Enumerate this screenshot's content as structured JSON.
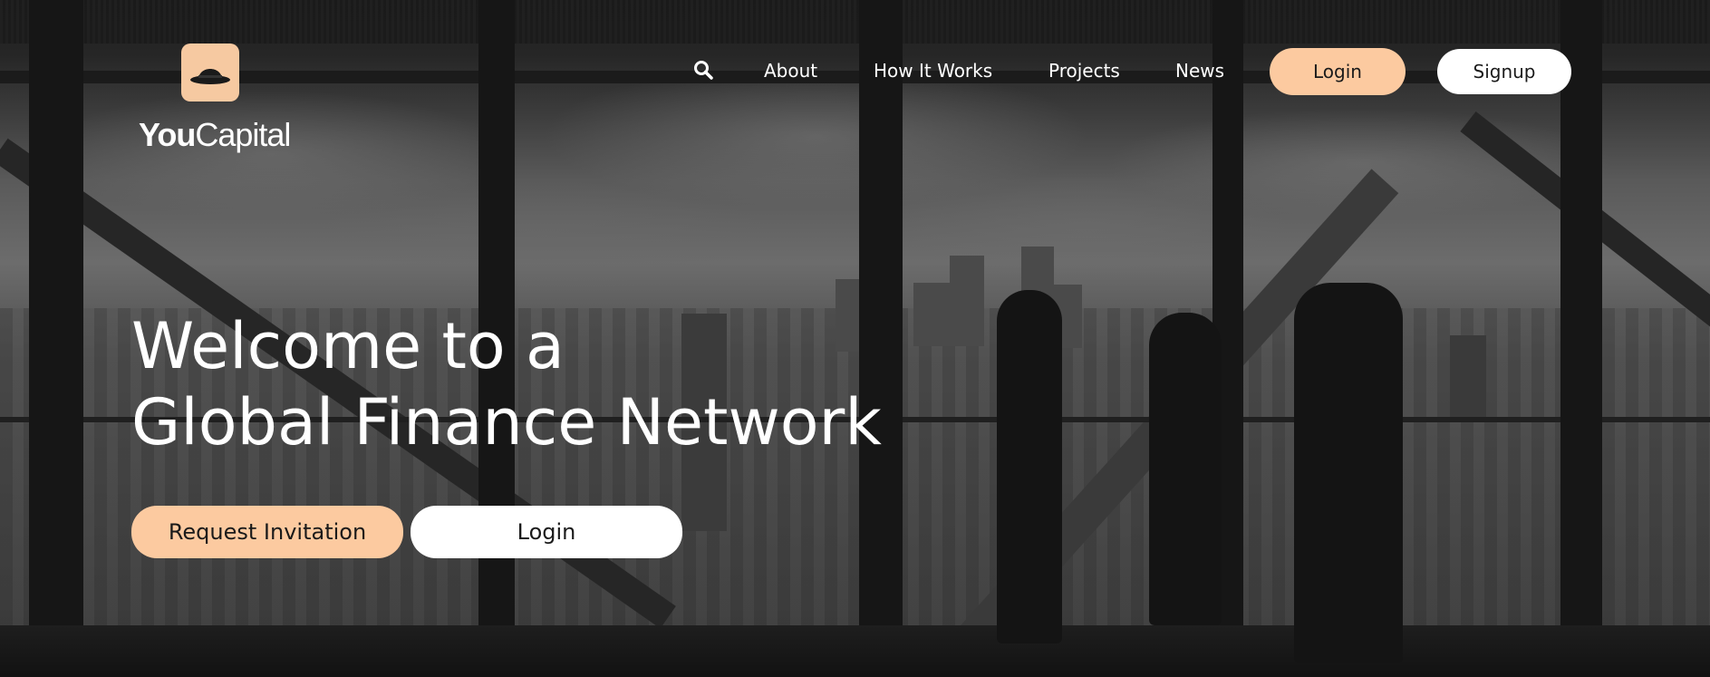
{
  "brand": {
    "logo_icon": "bowler-hat-icon",
    "name_bold": "You",
    "name_light": "Capital",
    "accent_color": "#fccaa0"
  },
  "nav": {
    "search_icon": "search-icon",
    "links": [
      "About",
      "How It Works",
      "Projects",
      "News"
    ],
    "login_label": "Login",
    "signup_label": "Signup"
  },
  "hero": {
    "headline_line1": "Welcome to a",
    "headline_line2": "Global Finance Network",
    "primary_cta": "Request Invitation",
    "secondary_cta": "Login"
  }
}
